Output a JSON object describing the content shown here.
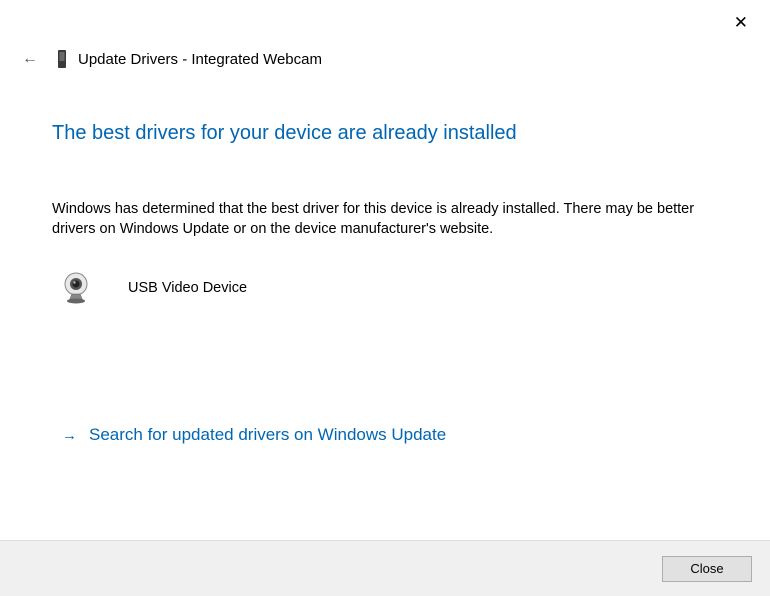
{
  "window": {
    "close_icon": "✕"
  },
  "header": {
    "back_icon": "←",
    "title": "Update Drivers - Integrated Webcam"
  },
  "main": {
    "heading": "The best drivers for your device are already installed",
    "description": "Windows has determined that the best driver for this device is already installed. There may be better drivers on Windows Update or on the device manufacturer's website.",
    "device_name": "USB Video Device"
  },
  "link": {
    "arrow": "→",
    "text": "Search for updated drivers on Windows Update"
  },
  "footer": {
    "close_label": "Close"
  },
  "colors": {
    "accent": "#0066b3",
    "footer_bg": "#f0f0f0",
    "button_bg": "#e1e1e1",
    "button_border": "#adadad"
  }
}
